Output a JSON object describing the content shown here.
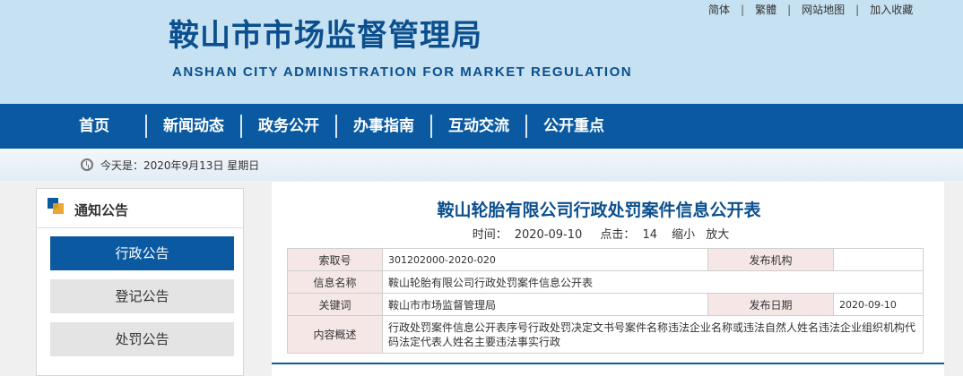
{
  "header": {
    "title_cn": "鞍山市市场监督管理局",
    "title_en": "ANSHAN CITY ADMINISTRATION FOR MARKET REGULATION",
    "links": [
      "简体",
      "繁體",
      "网站地图",
      "加入收藏"
    ]
  },
  "nav": {
    "items": [
      "首页",
      "新闻动态",
      "政务公开",
      "办事指南",
      "互动交流",
      "公开重点"
    ]
  },
  "datebar": {
    "text": "今天是：2020年9月13日 星期日"
  },
  "sidebar": {
    "title": "通知公告",
    "items": [
      "行政公告",
      "登记公告",
      "处罚公告"
    ],
    "active_index": 0
  },
  "article": {
    "title": "鞍山轮胎有限公司行政处罚案件信息公开表",
    "time_label": "时间：",
    "time_value": "2020-09-10",
    "clicks_label": "点击：",
    "clicks_value": "14",
    "zoom_out": "缩小",
    "zoom_in": "放大"
  },
  "info_table": {
    "index_label": "索取号",
    "index_value": "301202000-2020-020",
    "publisher_label": "发布机构",
    "publisher_value": "",
    "name_label": "信息名称",
    "name_value": "鞍山轮胎有限公司行政处罚案件信息公开表",
    "keyword_label": "关键词",
    "keyword_value": "鞍山市市场监督管理局",
    "date_label": "发布日期",
    "date_value": "2020-09-10",
    "summary_label": "内容概述",
    "summary_value": "行政处罚案件信息公开表序号行政处罚决定文书号案件名称违法企业名称或违法自然人姓名违法企业组织机构代码法定代表人姓名主要违法事实行政"
  },
  "colors": {
    "header_bg": "#c6e1f1",
    "brand_blue": "#0b5aa1",
    "label_bg": "#f6e7e7"
  }
}
